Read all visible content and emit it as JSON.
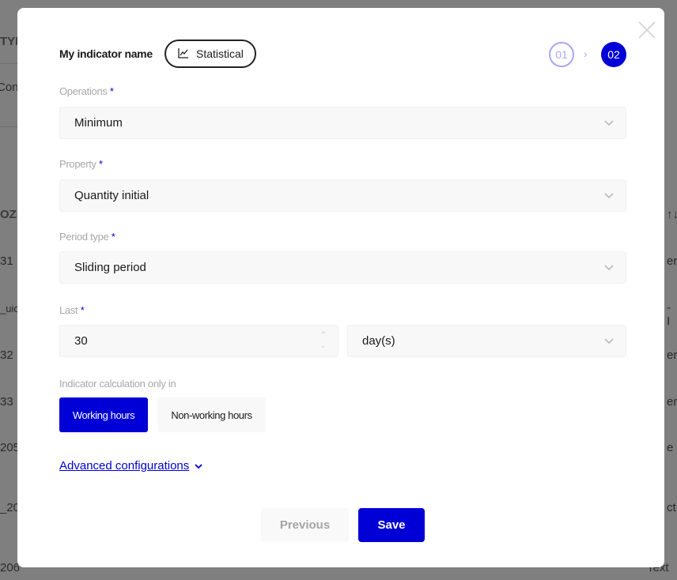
{
  "background": {
    "fragments_left": [
      "TYP",
      "Cont",
      "OZIO",
      "31",
      "_uic",
      "32",
      "33",
      "205",
      "_20",
      "206"
    ],
    "fragments_right": [
      "↑↓",
      "er",
      "- I",
      "er",
      "er",
      "e",
      "ct",
      "Text"
    ]
  },
  "modal": {
    "title": "My indicator name",
    "type_chip": {
      "label": "Statistical",
      "icon": "line-chart-icon"
    },
    "steps": [
      {
        "label": "01",
        "state": "done"
      },
      {
        "label": "02",
        "state": "active"
      }
    ],
    "step_separator": "›",
    "close_icon": "close-icon",
    "fields": {
      "operations": {
        "label": "Operations",
        "required": "*",
        "value": "Minimum"
      },
      "property": {
        "label": "Property",
        "required": "*",
        "value": "Quantity initial"
      },
      "period_type": {
        "label": "Period type",
        "required": "*",
        "value": "Sliding period"
      },
      "last": {
        "label": "Last",
        "required": "*",
        "value": "30",
        "unit": "day(s)"
      }
    },
    "calc": {
      "label": "Indicator calculation only in",
      "options": [
        {
          "label": "Working hours",
          "selected": true
        },
        {
          "label": "Non-working hours",
          "selected": false
        }
      ]
    },
    "advanced_label": "Advanced configurations",
    "previous_label": "Previous",
    "save_label": "Save"
  },
  "colors": {
    "accent": "#0000d6",
    "step_done": "#a9a7f5",
    "overlay": "#7f7f7f"
  }
}
